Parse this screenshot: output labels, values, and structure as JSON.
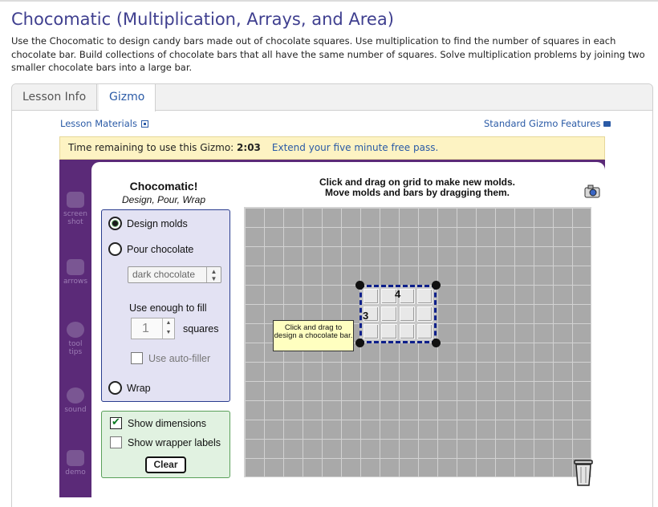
{
  "page": {
    "title": "Chocomatic (Multiplication, Arrays, and Area)",
    "description": "Use the Chocomatic to design candy bars made out of chocolate squares. Use multiplication to find the number of squares in each chocolate bar. Build collections of chocolate bars that all have the same number of squares. Solve multiplication problems by joining two smaller chocolate bars into a large bar."
  },
  "tabs": [
    {
      "label": "Lesson Info"
    },
    {
      "label": "Gizmo",
      "active": true
    }
  ],
  "links": {
    "lesson_materials": "Lesson Materials",
    "standard_features": "Standard Gizmo Features"
  },
  "timer": {
    "prefix": "Time remaining to use this Gizmo: ",
    "time": "2:03",
    "extend": "Extend your five minute free pass."
  },
  "side_nav": [
    {
      "label_1": "screen",
      "label_2": "shot",
      "icon": "camera-icon"
    },
    {
      "label_1": "arrows",
      "label_2": "",
      "icon": "arrows-icon"
    },
    {
      "label_1": "tool",
      "label_2": "tips",
      "icon": "tooltip-icon"
    },
    {
      "label_1": "sound",
      "label_2": "",
      "icon": "sound-icon"
    },
    {
      "label_1": "demo",
      "label_2": "",
      "icon": "demo-icon"
    }
  ],
  "gizmo": {
    "title": "Chocomatic!",
    "subtitle": "Design, Pour, Wrap",
    "instructions_line1": "Click and drag on grid to make new molds.",
    "instructions_line2": "Move molds and bars by dragging them.",
    "modes": {
      "design": "Design molds",
      "pour": "Pour chocolate",
      "wrap": "Wrap",
      "selected": "design"
    },
    "chocolate_select": "dark chocolate",
    "fill_label": "Use enough to fill",
    "fill_value": "1",
    "squares_label": "squares",
    "auto_filler": "Use auto-filler",
    "show_dimensions": "Show dimensions",
    "show_dimensions_checked": true,
    "show_wrapper_labels": "Show wrapper labels",
    "show_wrapper_labels_checked": false,
    "clear": "Clear",
    "mold": {
      "columns": "4",
      "rows": "3"
    },
    "tooltip": "Click and drag to design a chocolate bar."
  },
  "colors": {
    "title": "#3f3f8f",
    "link": "#2a5aa6",
    "frame": "#5b2a78",
    "timer_bg": "#fdf3c3",
    "mold_border": "#0d1f8a",
    "grid": "#a9a9a9"
  }
}
